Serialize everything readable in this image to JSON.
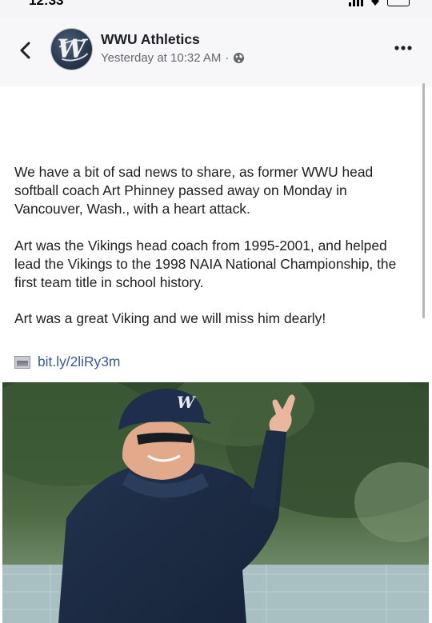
{
  "status_bar": {
    "time": "12:33"
  },
  "post": {
    "page_name": "WWU Athletics",
    "timestamp": "Yesterday at 10:32 AM",
    "separator": "·",
    "avatar_letter": "W",
    "paragraphs": [
      "We have a bit of sad news to share, as former WWU head softball coach Art Phinney passed away on Monday in Vancouver, Wash., with a heart attack.",
      "Art was the Vikings head coach from 1995-2001, and helped lead the Vikings to the 1998 NAIA National Championship, the first team title in school history.",
      "Art was a great Viking and we will miss him dearly!"
    ],
    "link_text": "bit.ly/2liRy3m",
    "cap_letter": "W"
  },
  "icons": {
    "back": "chevron-left-icon",
    "more": "more-dots-icon",
    "audience": "globe-icon",
    "link": "link-thumbnail-icon"
  },
  "colors": {
    "link": "#385898",
    "meta": "#65676b",
    "text": "#1c1e21",
    "header_bg": "#f7f7f9"
  }
}
